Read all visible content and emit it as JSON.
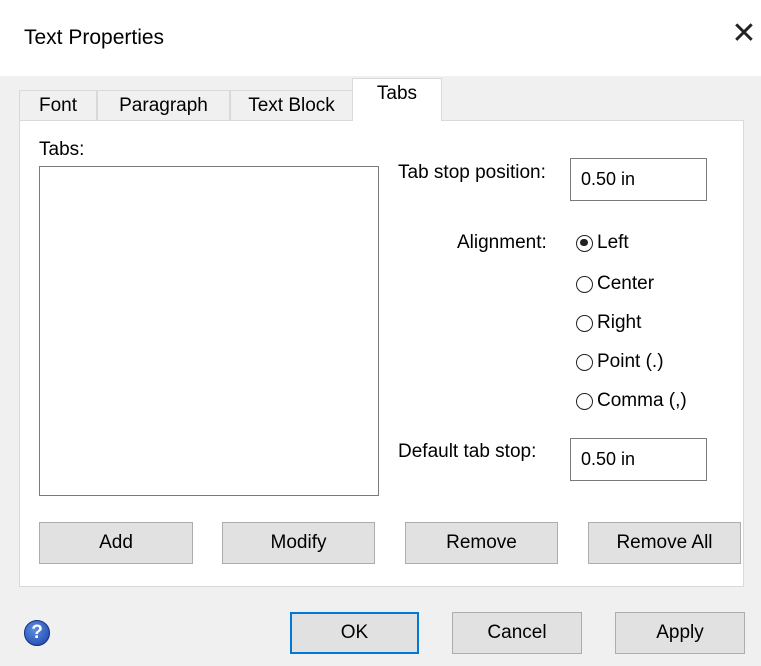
{
  "window": {
    "title": "Text Properties",
    "close_glyph": "✕"
  },
  "tabs": [
    {
      "label": "Font"
    },
    {
      "label": "Paragraph"
    },
    {
      "label": "Text Block"
    },
    {
      "label": "Tabs",
      "active": true
    }
  ],
  "tabs_page": {
    "tabs_list_label": "Tabs:",
    "tab_stop_position_label": "Tab stop position:",
    "tab_stop_position_value": "0.50 in",
    "alignment_label": "Alignment:",
    "alignment_options": [
      {
        "label": "Left",
        "selected": true
      },
      {
        "label": "Center",
        "selected": false
      },
      {
        "label": "Right",
        "selected": false
      },
      {
        "label": "Point (.)",
        "selected": false
      },
      {
        "label": "Comma (,)",
        "selected": false
      }
    ],
    "default_tab_stop_label": "Default tab stop:",
    "default_tab_stop_value": "0.50 in",
    "buttons": {
      "add": "Add",
      "modify": "Modify",
      "remove": "Remove",
      "remove_all": "Remove All"
    }
  },
  "footer": {
    "help_glyph": "?",
    "ok": "OK",
    "cancel": "Cancel",
    "apply": "Apply"
  },
  "colors": {
    "dialog_bg": "#f0f0f0",
    "panel_bg": "#ffffff",
    "default_button_border": "#0078d7",
    "help_icon": "#1b3fa8"
  }
}
